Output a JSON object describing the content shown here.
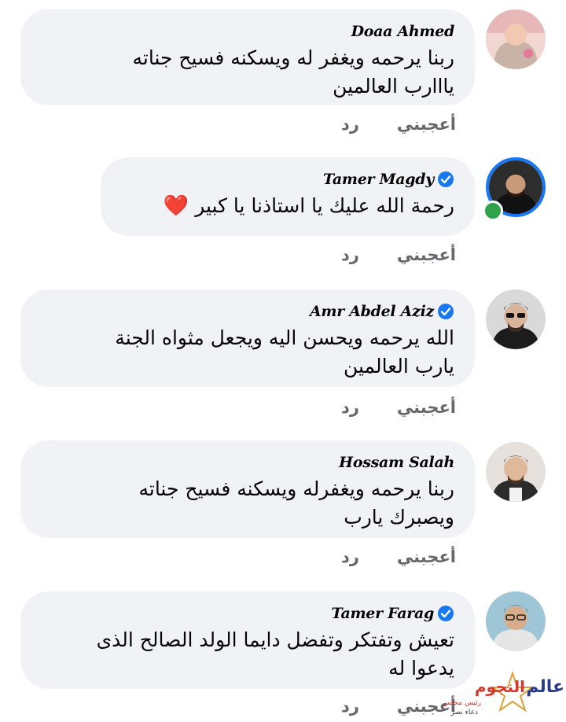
{
  "colors": {
    "bubble_bg": "#f0f2f5",
    "action_text": "#65676b",
    "verified_badge": "#1877f2",
    "online_dot": "#31a24c",
    "heart": "#e0245e"
  },
  "comments": [
    {
      "author": "Doaa Ahmed",
      "verified": false,
      "online": false,
      "avatar_icon": "avatar-woman-photo",
      "text": "ربنا يرحمه ويغفر له ويسكنه فسيح جناته\nيااارب العالمين",
      "like_label": "أعجبني",
      "reply_label": "رد"
    },
    {
      "author": "Tamer Magdy",
      "verified": true,
      "online": true,
      "avatar_icon": "avatar-man-photo",
      "text": "رحمة الله عليك يا استاذنا يا كبير",
      "emoji": "❤️",
      "like_label": "أعجبني",
      "reply_label": "رد"
    },
    {
      "author": "Amr Abdel Aziz",
      "verified": true,
      "online": false,
      "avatar_icon": "avatar-man-sunglasses-photo",
      "text": "الله يرحمه ويحسن اليه ويجعل مثواه الجنة\nيارب العالمين",
      "like_label": "أعجبني",
      "reply_label": "رد"
    },
    {
      "author": "Hossam Salah",
      "verified": false,
      "online": false,
      "avatar_icon": "avatar-man-photo",
      "text": "ربنا يرحمه ويغفرله ويسكنه فسيح جناته\nويصبرك يارب",
      "like_label": "أعجبني",
      "reply_label": "رد"
    },
    {
      "author": "Tamer Farag",
      "verified": true,
      "online": false,
      "avatar_icon": "avatar-man-glasses-photo",
      "text": "تعيش وتفتكر وتفضل دايما الولد الصالح الذى\nيدعوا له",
      "like_label": "أعجبني",
      "reply_label": "رد"
    }
  ],
  "watermark": {
    "logo_text": "عالم النجوم",
    "sub_text": "رئيس مجلس الإدارة",
    "name_text": "دعاء نصر"
  }
}
